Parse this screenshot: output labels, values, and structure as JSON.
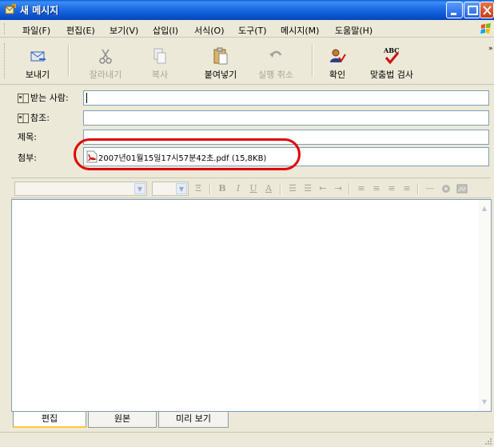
{
  "window": {
    "title": "새 메시지"
  },
  "menu": {
    "items": [
      "파일(F)",
      "편집(E)",
      "보기(V)",
      "삽입(I)",
      "서식(O)",
      "도구(T)",
      "메시지(M)",
      "도움말(H)"
    ]
  },
  "toolbar": {
    "send": "보내기",
    "cut": "잘라내기",
    "copy": "복사",
    "paste": "붙여넣기",
    "undo": "실행 취소",
    "check": "확인",
    "spelling": "맞춤법 검사",
    "spelling_icon_text": "ABC"
  },
  "header": {
    "to_label": "받는 사람:",
    "cc_label": "참조:",
    "subject_label": "제목:",
    "attach_label": "첨부:",
    "to_value": "",
    "cc_value": "",
    "subject_value": ""
  },
  "attachment": {
    "text": "2007년01월15일17시57분42초.pdf (15,8KB)"
  },
  "format": {
    "bold": "B",
    "italic": "I",
    "underline": "U",
    "font_color": "A"
  },
  "tabs": {
    "items": [
      "편집",
      "원본",
      "미리 보기"
    ],
    "active": "편집"
  },
  "colors": {
    "highlight": "#e00000",
    "titlebar": "#0a52cf"
  }
}
